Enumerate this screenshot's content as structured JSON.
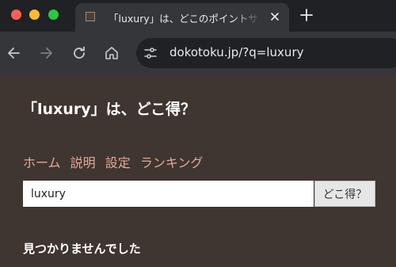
{
  "browser": {
    "tab": {
      "title": "「luxury」は、どこのポイントサ",
      "favicon_icon": "page-favicon-icon",
      "close_icon": "close-icon"
    },
    "new_tab_icon": "plus-icon",
    "nav_icons": [
      "back-arrow-icon",
      "forward-arrow-icon",
      "reload-icon",
      "home-icon"
    ],
    "address": {
      "url": "dokotoku.jp/?q=luxury",
      "icon": "site-settings-icon"
    }
  },
  "page": {
    "title": "「luxury」は、どこ得？",
    "nav": {
      "items": [
        "ホーム",
        "説明",
        "設定",
        "ランキング"
      ]
    },
    "search": {
      "value": "luxury",
      "button_label": "どこ得？"
    },
    "result_message": "見つかりませんでした"
  },
  "colors": {
    "page_background": "#3f3531",
    "nav_link": "#e6a89a",
    "heading_text": "#ffffff"
  }
}
